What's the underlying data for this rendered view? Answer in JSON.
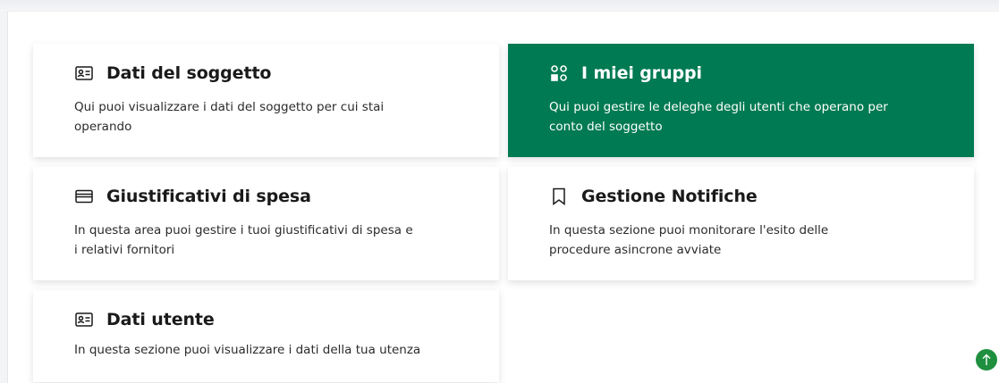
{
  "colors": {
    "accent": "#007a52",
    "scroll_button": "#1e8f3e"
  },
  "cards": [
    {
      "title": "Dati del soggetto",
      "description": "Qui puoi visualizzare i dati del soggetto per cui stai operando",
      "icon": "id-card-icon",
      "active": false
    },
    {
      "title": "I miei gruppi",
      "description": "Qui puoi gestire le deleghe degli utenti che operano per conto del soggetto",
      "icon": "groups-icon",
      "active": true
    },
    {
      "title": "Giustificativi di spesa",
      "description": "In questa area puoi gestire i tuoi giustificativi di spesa e i relativi fornitori",
      "icon": "credit-card-icon",
      "active": false
    },
    {
      "title": "Gestione Notifiche",
      "description": "In questa sezione puoi monitorare l'esito delle procedure asincrone avviate",
      "icon": "bookmark-icon",
      "active": false
    },
    {
      "title": "Dati utente",
      "description": "In questa sezione puoi visualizzare i dati della tua utenza",
      "icon": "id-card-icon",
      "active": false
    }
  ],
  "scroll_top": {
    "icon": "arrow-up-icon"
  }
}
